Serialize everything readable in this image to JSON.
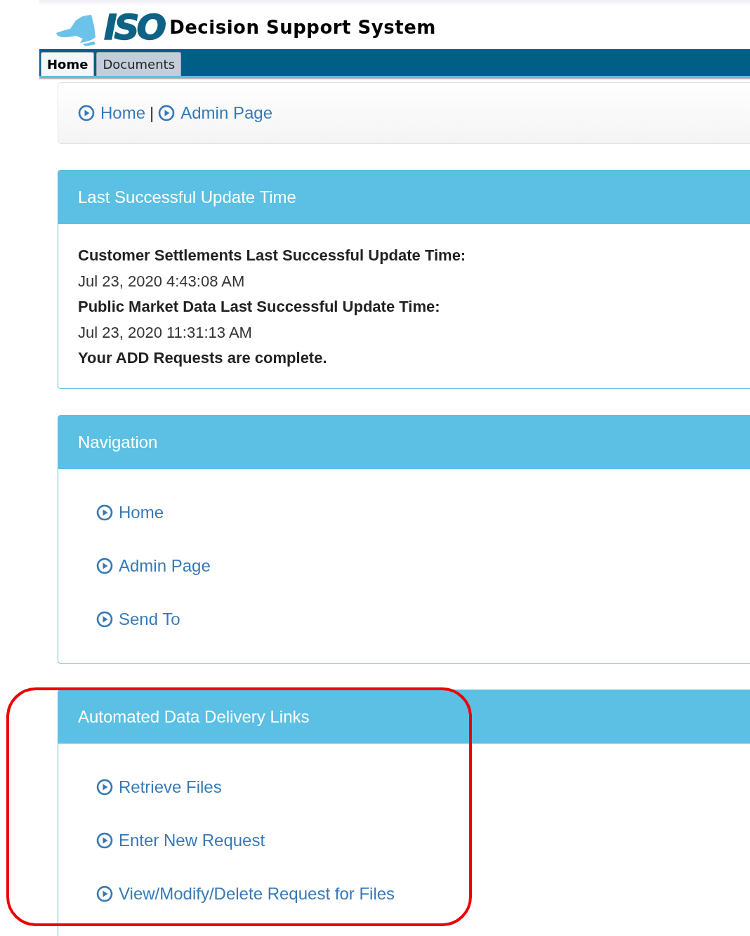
{
  "header": {
    "logo_text": "ISO",
    "title": "Decision Support System"
  },
  "tabs": [
    {
      "label": "Home",
      "selected": true
    },
    {
      "label": "Documents",
      "selected": false
    }
  ],
  "breadcrumb": {
    "links": [
      "Home",
      "Admin Page"
    ],
    "separator": "|"
  },
  "panels": [
    {
      "title": "Last Successful Update Time",
      "kind": "status",
      "highlighted": false,
      "lines": [
        {
          "text": "Customer Settlements Last Successful Update Time:",
          "bold": true
        },
        {
          "text": "Jul 23, 2020 4:43:08 AM",
          "bold": false
        },
        {
          "text": "Public Market Data Last Successful Update Time:",
          "bold": true
        },
        {
          "text": "Jul 23, 2020 11:31:13 AM",
          "bold": false
        },
        {
          "text": "Your ADD Requests are complete.",
          "bold": true
        }
      ]
    },
    {
      "title": "Navigation",
      "kind": "links",
      "highlighted": false,
      "links": [
        "Home",
        "Admin Page",
        "Send To"
      ]
    },
    {
      "title": "Automated Data Delivery Links",
      "kind": "links",
      "highlighted": true,
      "links": [
        "Retrieve Files",
        "Enter New Request",
        "View/Modify/Delete Request for Files"
      ]
    }
  ]
}
